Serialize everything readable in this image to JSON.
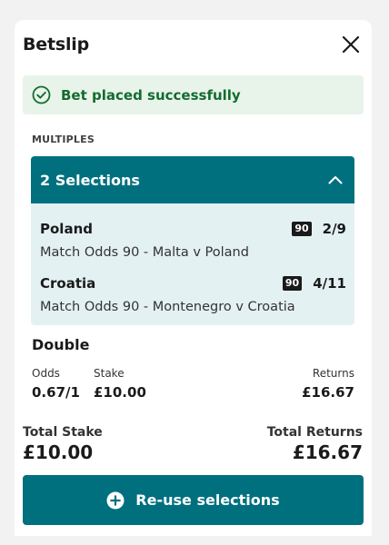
{
  "header": {
    "title": "Betslip"
  },
  "alert": {
    "message": "Bet placed successfully"
  },
  "section": {
    "label": "MULTIPLES"
  },
  "selections": {
    "summary": "2 Selections",
    "items": [
      {
        "team": "Poland",
        "badge": "90",
        "odds": "2/9",
        "market": "Match Odds 90 - Malta v Poland"
      },
      {
        "team": "Croatia",
        "badge": "90",
        "odds": "4/11",
        "market": "Match Odds 90 - Montenegro v Croatia"
      }
    ]
  },
  "bet": {
    "type": "Double",
    "odds_label": "Odds",
    "odds_value": "0.67/1",
    "stake_label": "Stake",
    "stake_value": "£10.00",
    "returns_label": "Returns",
    "returns_value": "£16.67"
  },
  "totals": {
    "stake_label": "Total Stake",
    "stake_value": "£10.00",
    "returns_label": "Total Returns",
    "returns_value": "£16.67"
  },
  "actions": {
    "reuse_label": "Re-use selections"
  },
  "colors": {
    "brand": "#00707f",
    "success": "#146b2f",
    "success_bg": "#e8f4e9",
    "selection_bg": "#e4f1f3"
  }
}
